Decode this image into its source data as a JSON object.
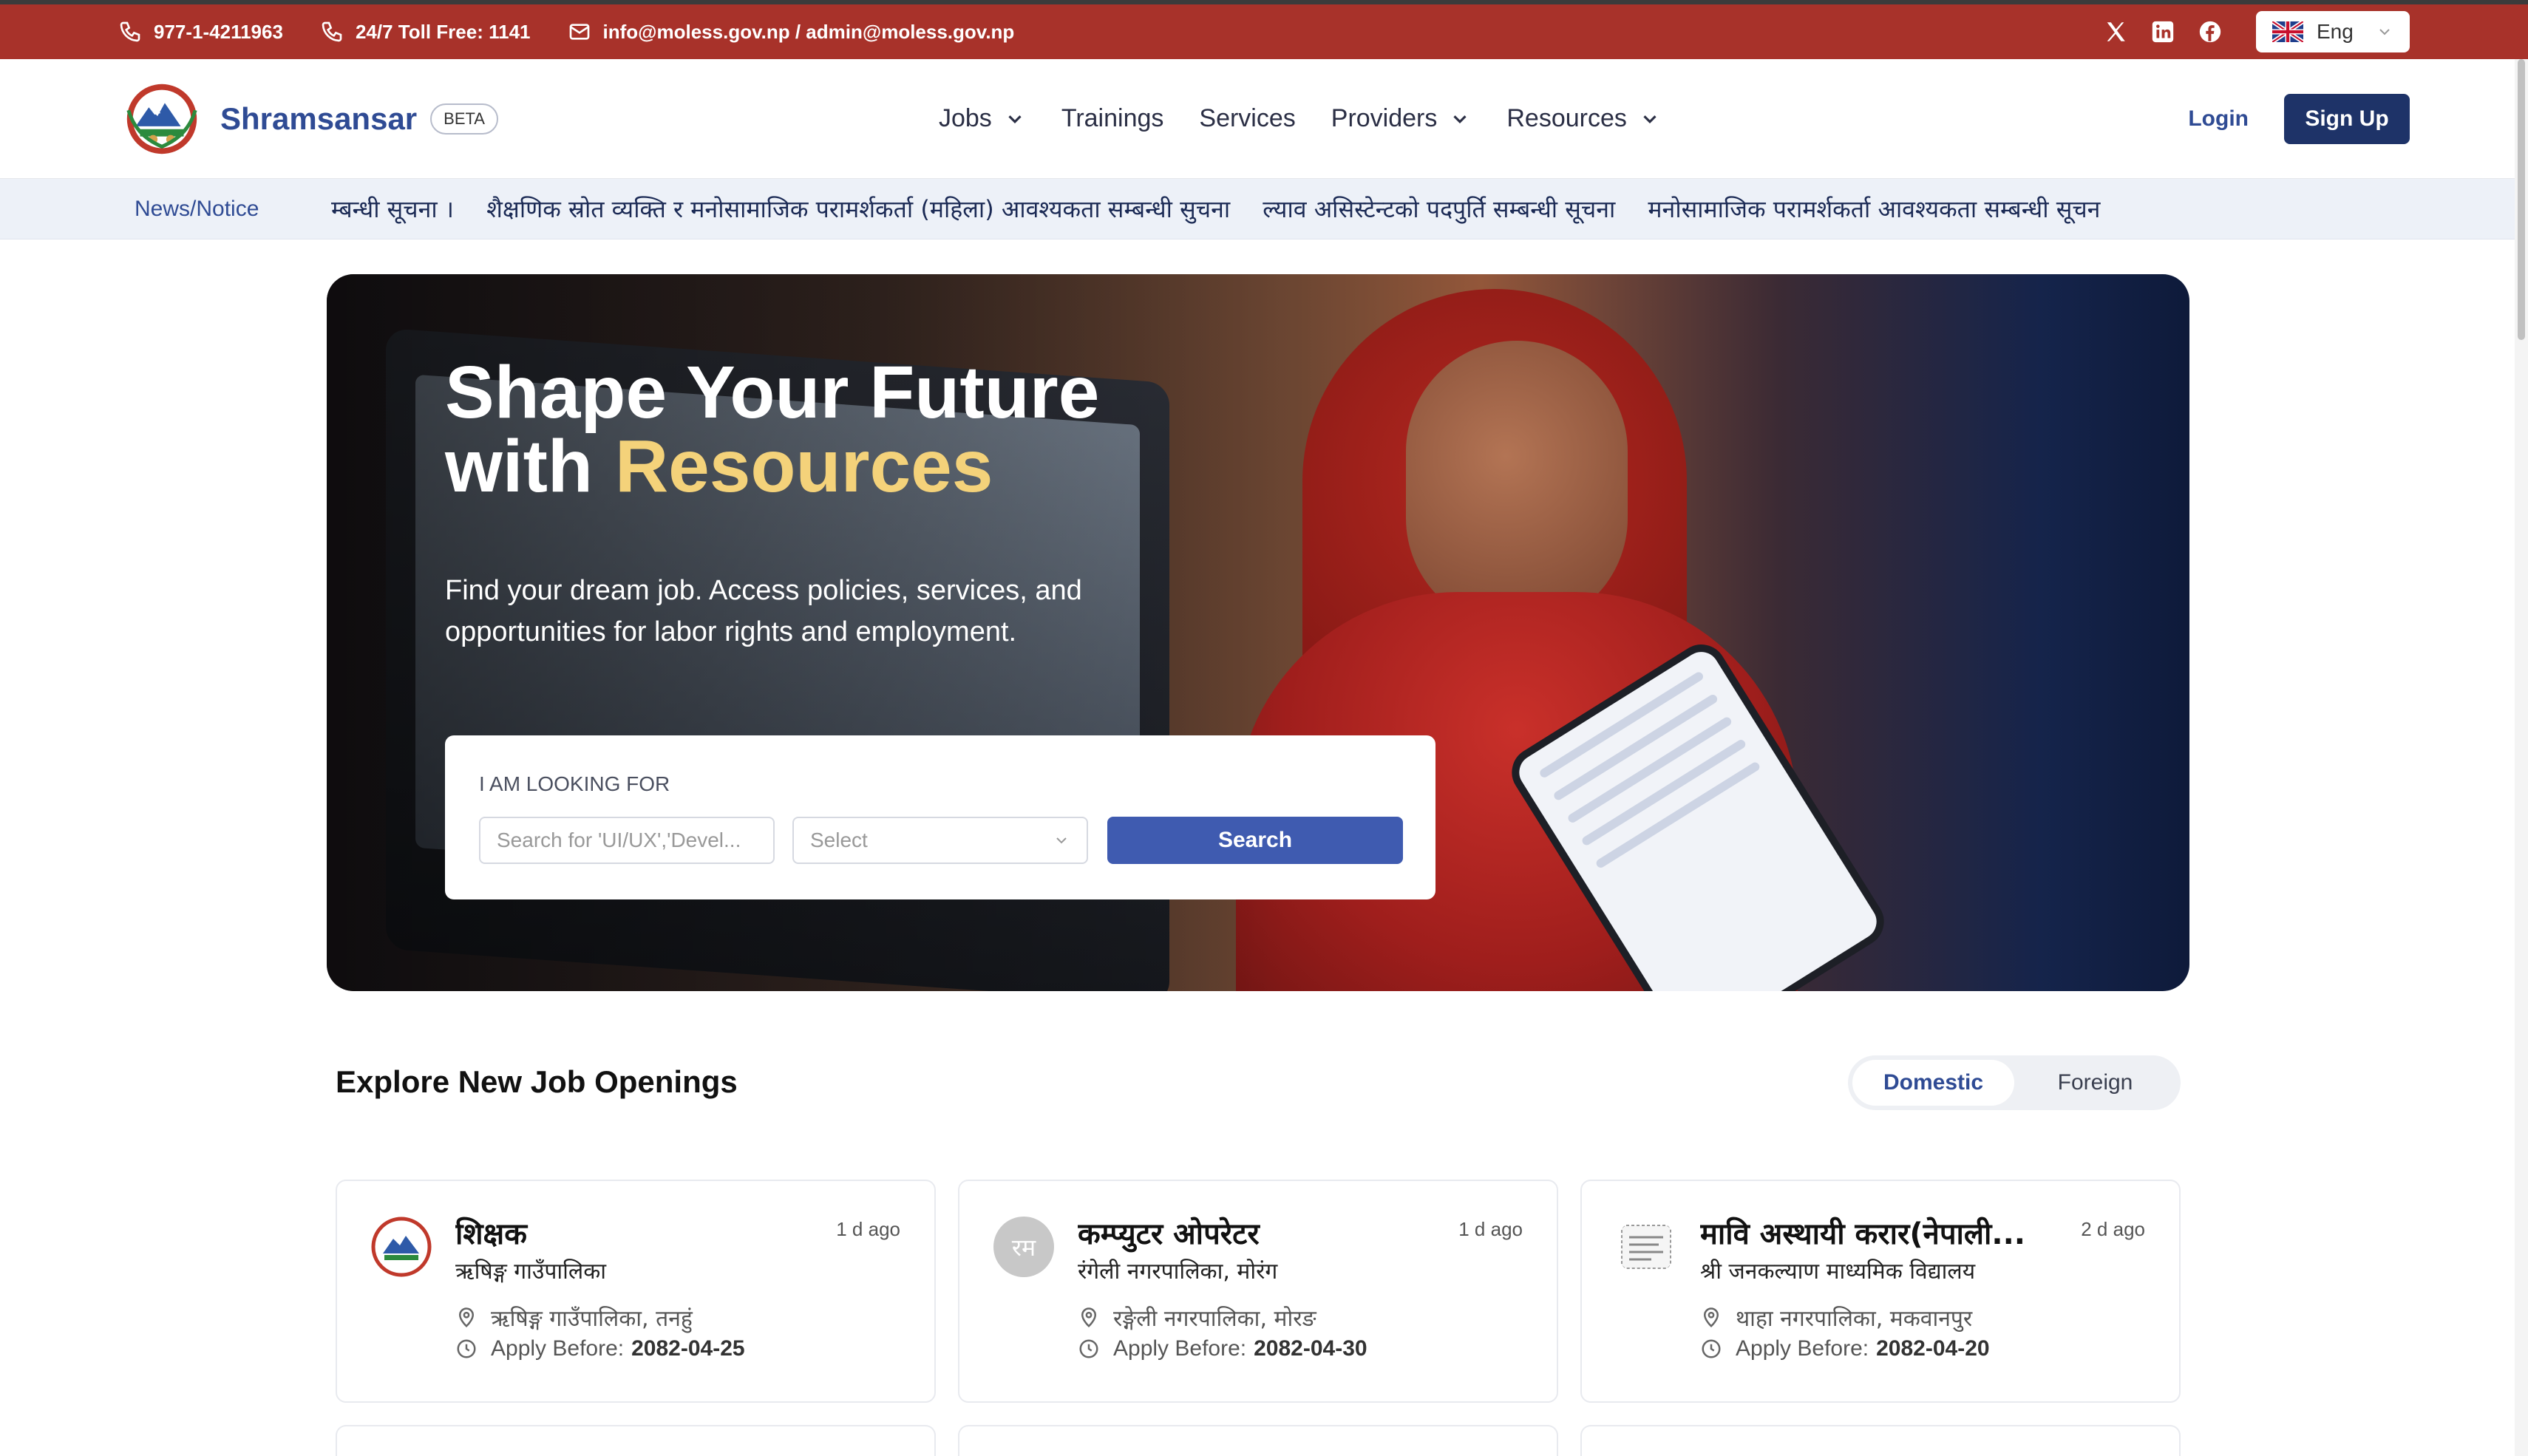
{
  "topbar": {
    "phone": "977-1-4211963",
    "tollfree": "24/7 Toll Free: 1141",
    "email": "info@moless.gov.np / admin@moless.gov.np",
    "social_icons": [
      "x-icon",
      "linkedin-icon",
      "facebook-icon"
    ],
    "language": "Eng",
    "background_color": "#a8322a"
  },
  "navbar": {
    "brand": "Shramsansar",
    "badge": "BETA",
    "items": [
      {
        "label": "Jobs",
        "has_dropdown": true
      },
      {
        "label": "Trainings",
        "has_dropdown": false
      },
      {
        "label": "Services",
        "has_dropdown": false
      },
      {
        "label": "Providers",
        "has_dropdown": true
      },
      {
        "label": "Resources",
        "has_dropdown": true
      }
    ],
    "login": "Login",
    "signup": "Sign Up",
    "accent_color": "#1e3368"
  },
  "ticker": {
    "label": "News/Notice",
    "items": [
      "म्बन्धी सूचना ।",
      "शैक्षणिक स्रोत व्यक्ति र मनोसामाजिक परामर्शकर्ता (महिला) आवश्यकता सम्बन्धी सुचना",
      "ल्याव असिस्टेन्टको पदपुर्ति सम्बन्धी सूचना",
      "मनोसामाजिक परामर्शकर्ता आवश्यकता सम्बन्धी सूचन"
    ]
  },
  "hero": {
    "title_line1": "Shape Your Future",
    "title_line2_prefix": "with",
    "title_line2_accent": "Resources",
    "subtitle": "Find your dream job. Access policies, services, and opportunities for labor rights and employment.",
    "search": {
      "label": "I AM LOOKING FOR",
      "placeholder": "Search for 'UI/UX','Devel...",
      "select_value": "Select",
      "button": "Search"
    }
  },
  "jobs": {
    "section_title": "Explore New Job Openings",
    "tabs": [
      {
        "label": "Domestic",
        "active": true
      },
      {
        "label": "Foreign",
        "active": false
      }
    ],
    "apply_prefix": "Apply Before:",
    "cards": [
      {
        "title": "शिक्षक",
        "org": "ऋषिङ्ग गाउँपालिका",
        "ago": "1 d ago",
        "location": "ऋषिङ्ग गाउँपालिका, तनहुं",
        "deadline": "2082-04-25",
        "logo": "emblem"
      },
      {
        "title": "कम्प्युटर ओपरेटर",
        "org": "रंगेली नगरपालिका, मोरंग",
        "ago": "1 d ago",
        "location": "रङ्गेली नगरपालिका, मोरङ",
        "deadline": "2082-04-30",
        "logo": "initials",
        "initials": "रम"
      },
      {
        "title": "मावि अस्थायी करार(नेपाली...",
        "org": "श्री जनकल्याण माध्यमिक विद्यालय",
        "ago": "2 d ago",
        "location": "थाहा नगरपालिका, मकवानपुर",
        "deadline": "2082-04-20",
        "logo": "stamp"
      }
    ]
  }
}
